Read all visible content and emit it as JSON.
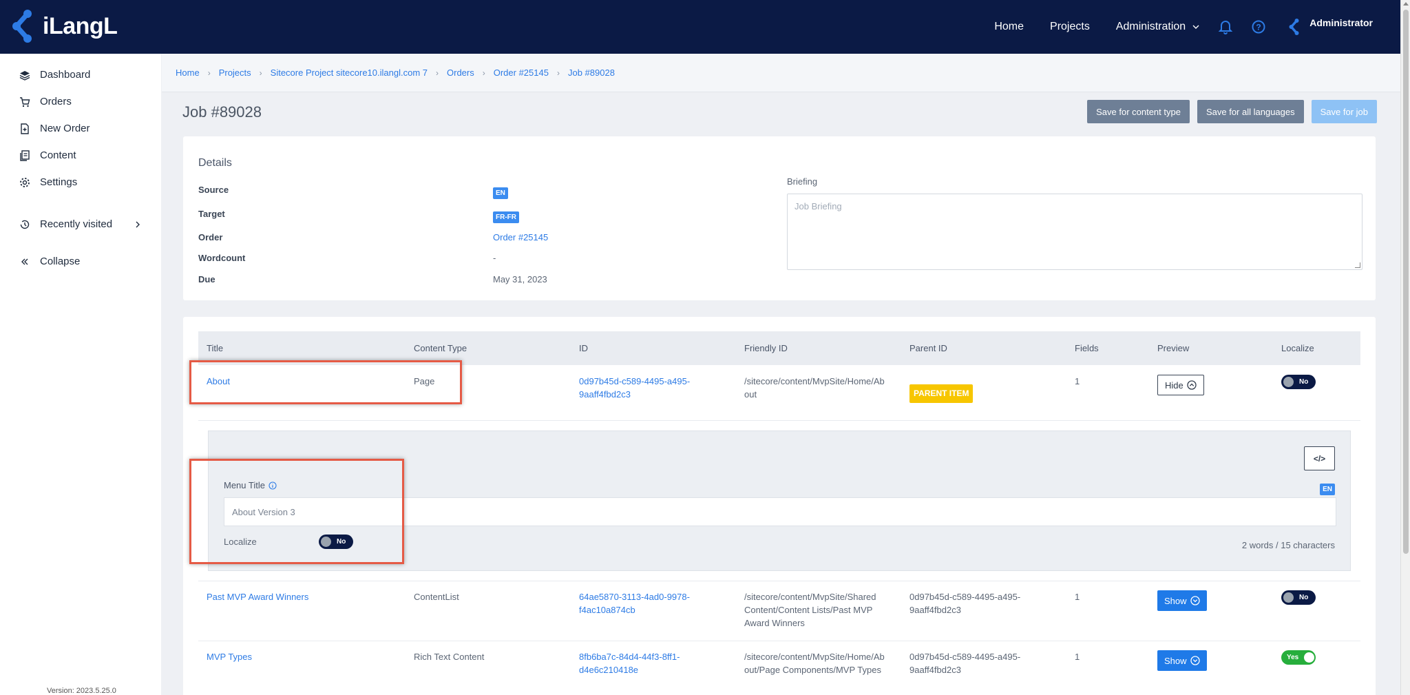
{
  "brand": {
    "name": "iLangL"
  },
  "nav": {
    "home": "Home",
    "projects": "Projects",
    "administration": "Administration",
    "user": "Administrator"
  },
  "sidebar": {
    "items": [
      {
        "label": "Dashboard",
        "icon": "layers-icon"
      },
      {
        "label": "Orders",
        "icon": "cart-icon"
      },
      {
        "label": "New Order",
        "icon": "new-file-icon"
      },
      {
        "label": "Content",
        "icon": "content-icon"
      },
      {
        "label": "Settings",
        "icon": "gear-icon"
      }
    ],
    "recently_visited": "Recently visited",
    "collapse": "Collapse",
    "version": "Version: 2023.5.25.0"
  },
  "breadcrumb": [
    "Home",
    "Projects",
    "Sitecore Project sitecore10.ilangl.com 7",
    "Orders",
    "Order #25145",
    "Job #89028"
  ],
  "page": {
    "title": "Job #89028"
  },
  "actions": {
    "save_content_type": "Save for content type",
    "save_all_languages": "Save for all languages",
    "save_job": "Save for job"
  },
  "details": {
    "heading": "Details",
    "source_label": "Source",
    "source": "EN",
    "target_label": "Target",
    "target": "FR-FR",
    "order_label": "Order",
    "order": "Order #25145",
    "wordcount_label": "Wordcount",
    "wordcount": "-",
    "due_label": "Due",
    "due": "May 31, 2023",
    "briefing_label": "Briefing",
    "briefing_placeholder": "Job Briefing"
  },
  "table": {
    "headers": [
      "Title",
      "Content Type",
      "ID",
      "Friendly ID",
      "Parent ID",
      "Fields",
      "Preview",
      "Localize"
    ],
    "rows": [
      {
        "title": "About",
        "content_type": "Page",
        "id_line1": "0d97b45d-c589-4495-a495-",
        "id_line2": "9aaff4fbd2c3",
        "friendly_line1": "/sitecore/content/MvpSite/Home/Ab",
        "friendly_line2": "out",
        "friendly_line3": "",
        "parent": "PARENT ITEM",
        "fields": "1",
        "preview": "Hide",
        "localize": "No"
      },
      {
        "title": "Past MVP Award Winners",
        "content_type": "ContentList",
        "id_line1": "64ae5870-3113-4ad0-9978-",
        "id_line2": "f4ac10a874cb",
        "friendly_line1": "/sitecore/content/MvpSite/Shared",
        "friendly_line2": "Content/Content Lists/Past MVP",
        "friendly_line3": "Award Winners",
        "parent_line1": "0d97b45d-c589-4495-a495-",
        "parent_line2": "9aaff4fbd2c3",
        "fields": "1",
        "preview": "Show",
        "localize": "No"
      },
      {
        "title": "MVP Types",
        "content_type": "Rich Text Content",
        "id_line1": "8fb6ba7c-84d4-44f3-8ff1-",
        "id_line2": "d4e6c210418e",
        "friendly_line1": "/sitecore/content/MvpSite/Home/Ab",
        "friendly_line2": "out/Page Components/MVP Types",
        "friendly_line3": "",
        "parent_line1": "0d97b45d-c589-4495-a495-",
        "parent_line2": "9aaff4fbd2c3",
        "fields": "1",
        "preview": "Show",
        "localize": "Yes"
      }
    ]
  },
  "preview_panel": {
    "field_label": "Menu Title",
    "field_value": "About Version 3",
    "lang": "EN",
    "localize_label": "Localize",
    "localize": "No",
    "counter": "2 words / 15 characters"
  },
  "colors": {
    "navy": "#0b1a45",
    "link": "#2d7be5",
    "highlight": "#e55a45",
    "badge_yellow": "#f7c600",
    "toggle_on": "#27ae3c"
  }
}
